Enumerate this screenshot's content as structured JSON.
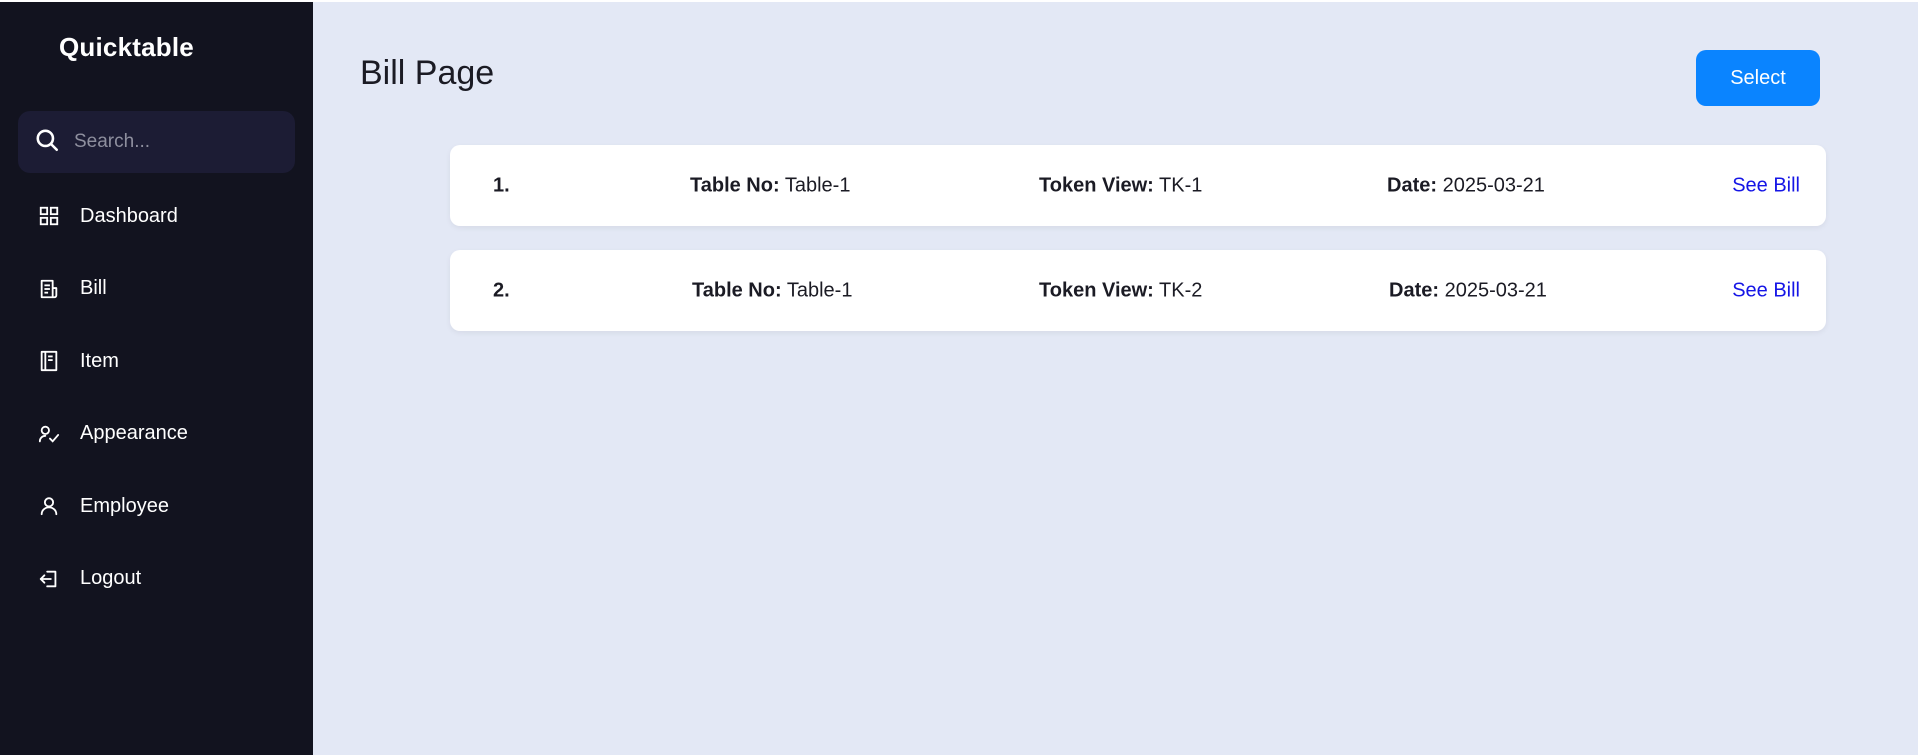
{
  "sidebar": {
    "brand": "Quicktable",
    "search_placeholder": "Search...",
    "items": [
      {
        "label": "Dashboard",
        "icon": "dashboard-grid-icon"
      },
      {
        "label": "Bill",
        "icon": "receipt-icon"
      },
      {
        "label": "Item",
        "icon": "notebook-icon"
      },
      {
        "label": "Appearance",
        "icon": "user-check-icon"
      },
      {
        "label": "Employee",
        "icon": "user-icon"
      },
      {
        "label": "Logout",
        "icon": "logout-icon"
      }
    ]
  },
  "main": {
    "title": "Bill Page",
    "select_label": "Select",
    "labels": {
      "table": "Table No:",
      "token": "Token View:",
      "date": "Date:"
    },
    "bills": [
      {
        "index": "1.",
        "table": "Table-1",
        "token": "TK-1",
        "date": "2025-03-21",
        "link": "See Bill"
      },
      {
        "index": "2.",
        "table": "Table-1",
        "token": "TK-2",
        "date": "2025-03-21",
        "link": "See Bill"
      }
    ]
  },
  "colors": {
    "sidebar_bg": "#12131f",
    "main_bg": "#e3e8f5",
    "accent": "#0a84ff",
    "link": "#1515e6"
  }
}
